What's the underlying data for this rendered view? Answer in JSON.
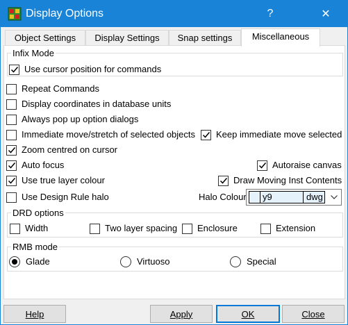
{
  "window": {
    "title": "Display Options",
    "help_glyph": "?",
    "close_glyph": "✕"
  },
  "tabs": [
    {
      "label": "Object Settings",
      "active": false
    },
    {
      "label": "Display Settings",
      "active": false
    },
    {
      "label": "Snap settings",
      "active": false
    },
    {
      "label": "Miscellaneous",
      "active": true
    }
  ],
  "infix_mode": {
    "label": "Infix Mode",
    "use_cursor_position": {
      "label": "Use cursor position for commands",
      "checked": true
    }
  },
  "options": {
    "repeat_commands": {
      "label": "Repeat Commands",
      "checked": false
    },
    "display_coords_db_units": {
      "label": "Display coordinates in database units",
      "checked": false
    },
    "always_pop_up": {
      "label": "Always pop up option dialogs",
      "checked": false
    },
    "immediate_move": {
      "label": "Immediate move/stretch of selected objects",
      "checked": false
    },
    "keep_immediate_move": {
      "label": "Keep immediate move selected",
      "checked": true
    },
    "zoom_centred": {
      "label": "Zoom centred on cursor",
      "checked": true
    },
    "auto_focus": {
      "label": "Auto focus",
      "checked": true
    },
    "autoraise_canvas": {
      "label": "Autoraise canvas",
      "checked": true
    },
    "use_true_layer_colour": {
      "label": "Use true layer colour",
      "checked": true
    },
    "draw_moving_inst": {
      "label": "Draw Moving Inst Contents",
      "checked": true
    },
    "use_design_rule_halo": {
      "label": "Use Design Rule halo",
      "checked": false
    }
  },
  "halo_colour": {
    "label": "Halo Colour",
    "layer_name": "y9",
    "purpose": "dwg",
    "swatch_color": "#e5f1fb"
  },
  "drd_options": {
    "label": "DRD options",
    "width": {
      "label": "Width",
      "checked": false
    },
    "two_layer_spacing": {
      "label": "Two layer spacing",
      "checked": false
    },
    "enclosure": {
      "label": "Enclosure",
      "checked": false
    },
    "extension": {
      "label": "Extension",
      "checked": false
    }
  },
  "rmb_mode": {
    "label": "RMB mode",
    "options": [
      {
        "label": "Glade",
        "selected": true
      },
      {
        "label": "Virtuoso",
        "selected": false
      },
      {
        "label": "Special",
        "selected": false
      }
    ]
  },
  "buttons": {
    "help": "Help",
    "apply": "Apply",
    "ok": "OK",
    "close": "Close"
  },
  "colors": {
    "title_bar": "#1883d7",
    "ok_border": "#0078d7"
  }
}
